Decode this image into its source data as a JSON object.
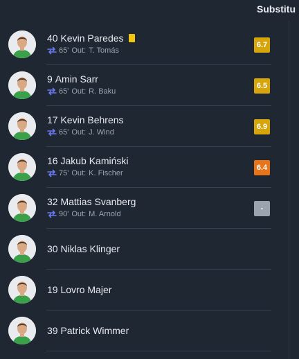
{
  "panel": {
    "title": "Substitu"
  },
  "players": [
    {
      "number": "40",
      "name": "Kevin Paredes",
      "yellow_card": true,
      "sub_minute": "65'",
      "out_label": "Out:",
      "out_player": "T. Tomás",
      "rating": "6.7",
      "rating_color": "#d6a40b"
    },
    {
      "number": "9",
      "name": "Amin Sarr",
      "yellow_card": false,
      "sub_minute": "65'",
      "out_label": "Out:",
      "out_player": "R. Baku",
      "rating": "6.5",
      "rating_color": "#d6a40b"
    },
    {
      "number": "17",
      "name": "Kevin Behrens",
      "yellow_card": false,
      "sub_minute": "65'",
      "out_label": "Out:",
      "out_player": "J. Wind",
      "rating": "6.9",
      "rating_color": "#d6a40b"
    },
    {
      "number": "16",
      "name": "Jakub Kamiński",
      "yellow_card": false,
      "sub_minute": "75'",
      "out_label": "Out:",
      "out_player": "K. Fischer",
      "rating": "6.4",
      "rating_color": "#e8741a"
    },
    {
      "number": "32",
      "name": "Mattias Svanberg",
      "yellow_card": false,
      "sub_minute": "90'",
      "out_label": "Out:",
      "out_player": "M. Arnold",
      "rating": "-",
      "rating_color": "#9ba3ae"
    },
    {
      "number": "30",
      "name": "Niklas Klinger",
      "yellow_card": false,
      "sub_minute": "",
      "out_label": "",
      "out_player": "",
      "rating": "",
      "rating_color": ""
    },
    {
      "number": "19",
      "name": "Lovro Majer",
      "yellow_card": false,
      "sub_minute": "",
      "out_label": "",
      "out_player": "",
      "rating": "",
      "rating_color": ""
    },
    {
      "number": "39",
      "name": "Patrick Wimmer",
      "yellow_card": false,
      "sub_minute": "",
      "out_label": "",
      "out_player": "",
      "rating": "",
      "rating_color": ""
    }
  ],
  "colors": {
    "swap_icon": "#6b79f0",
    "jersey": "#3aa04a",
    "skin": "#d9a985"
  }
}
